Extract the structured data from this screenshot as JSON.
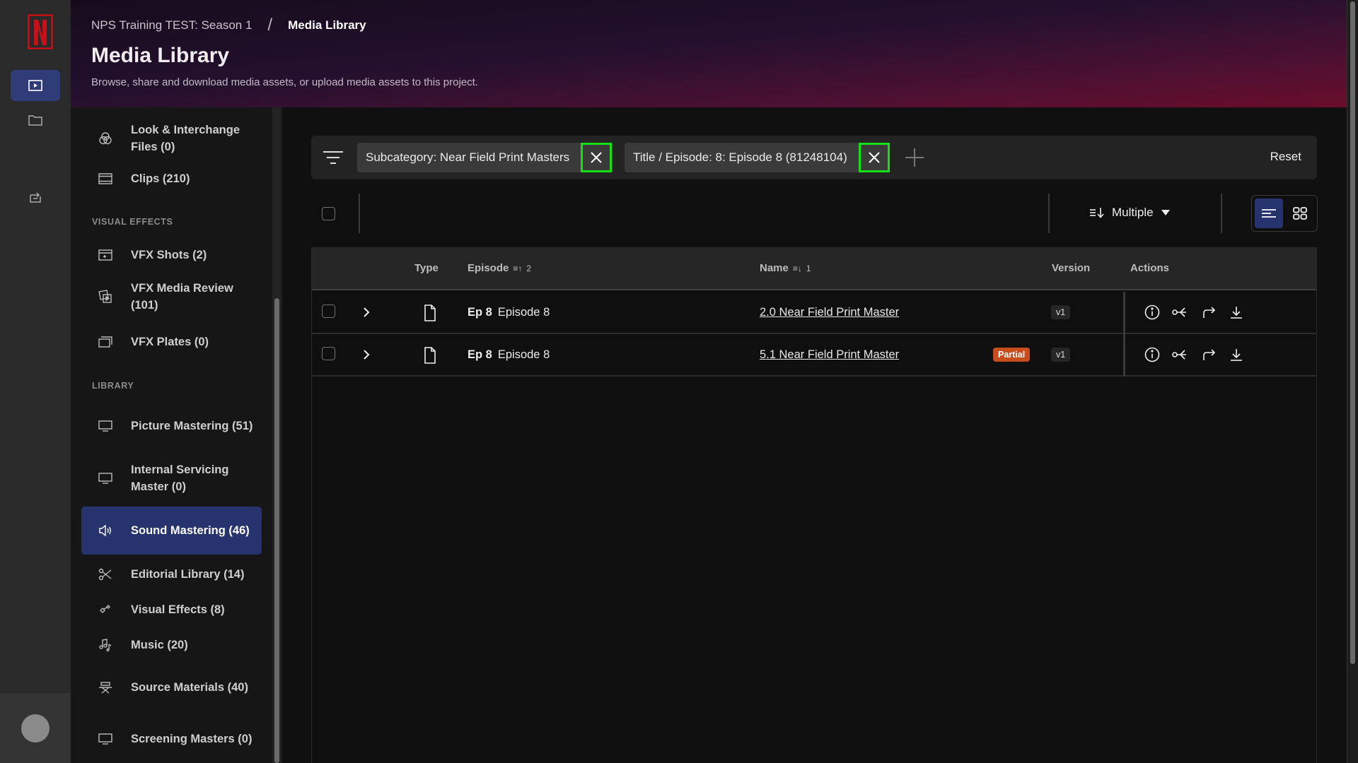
{
  "breadcrumb": {
    "project": "NPS Training TEST: Season 1",
    "separator": "/",
    "current": "Media Library"
  },
  "header": {
    "title": "Media Library",
    "subtitle": "Browse, share and download media assets, or upload media assets to this project."
  },
  "rail": {
    "items": [
      {
        "icon": "media-play-icon",
        "active": true
      },
      {
        "icon": "folder-icon",
        "active": false
      },
      {
        "icon": "inbox-transfer-icon",
        "active": false
      }
    ]
  },
  "sidebar": {
    "sections": {
      "visual_effects": "VISUAL EFFECTS",
      "library": "LIBRARY"
    },
    "items": [
      {
        "label": "Look & Interchange Files (0)",
        "icon": "color-circles-icon"
      },
      {
        "label": "Clips (210)",
        "icon": "film-strip-icon"
      },
      {
        "label": "VFX Shots (2)",
        "icon": "vfx-clapper-icon"
      },
      {
        "label": "VFX Media Review (101)",
        "icon": "media-review-icon"
      },
      {
        "label": "VFX Plates (0)",
        "icon": "plates-icon"
      },
      {
        "label": "Picture Mastering (51)",
        "icon": "monitor-icon"
      },
      {
        "label": "Internal Servicing Master (0)",
        "icon": "monitor-icon"
      },
      {
        "label": "Sound Mastering (46)",
        "icon": "speaker-icon",
        "active": true
      },
      {
        "label": "Editorial Library (14)",
        "icon": "scissors-icon"
      },
      {
        "label": "Visual Effects (8)",
        "icon": "sparkle-icon"
      },
      {
        "label": "Music (20)",
        "icon": "music-notes-icon"
      },
      {
        "label": "Source Materials (40)",
        "icon": "director-chair-icon"
      },
      {
        "label": "Screening Masters (0)",
        "icon": "monitor-icon"
      }
    ]
  },
  "filters": {
    "chips": [
      {
        "label": "Subcategory: Near Field Print Masters"
      },
      {
        "label": "Title / Episode: 8: Episode 8 (81248104)"
      }
    ],
    "reset_label": "Reset"
  },
  "toolbar": {
    "sort_label": "Multiple",
    "view_modes": [
      "list",
      "grid"
    ],
    "active_view": "list"
  },
  "table": {
    "columns": {
      "type": "Type",
      "episode": "Episode",
      "episode_sort": "2",
      "name": "Name",
      "name_sort": "1",
      "version": "Version",
      "actions": "Actions"
    },
    "rows": [
      {
        "ep_code": "Ep 8",
        "ep_name": "Episode 8",
        "name": "2.0 Near Field Print Master",
        "badge": "",
        "version": "v1"
      },
      {
        "ep_code": "Ep 8",
        "ep_name": "Episode 8",
        "name": "5.1 Near Field Print Master",
        "badge": "Partial",
        "version": "v1"
      }
    ],
    "actions": [
      "info-icon",
      "share-icon",
      "forward-icon",
      "download-icon"
    ]
  },
  "colors": {
    "accent": "#27336d",
    "partial_badge": "#c84d1c",
    "highlight_box": "#14e014",
    "brand_red": "#e50914"
  }
}
